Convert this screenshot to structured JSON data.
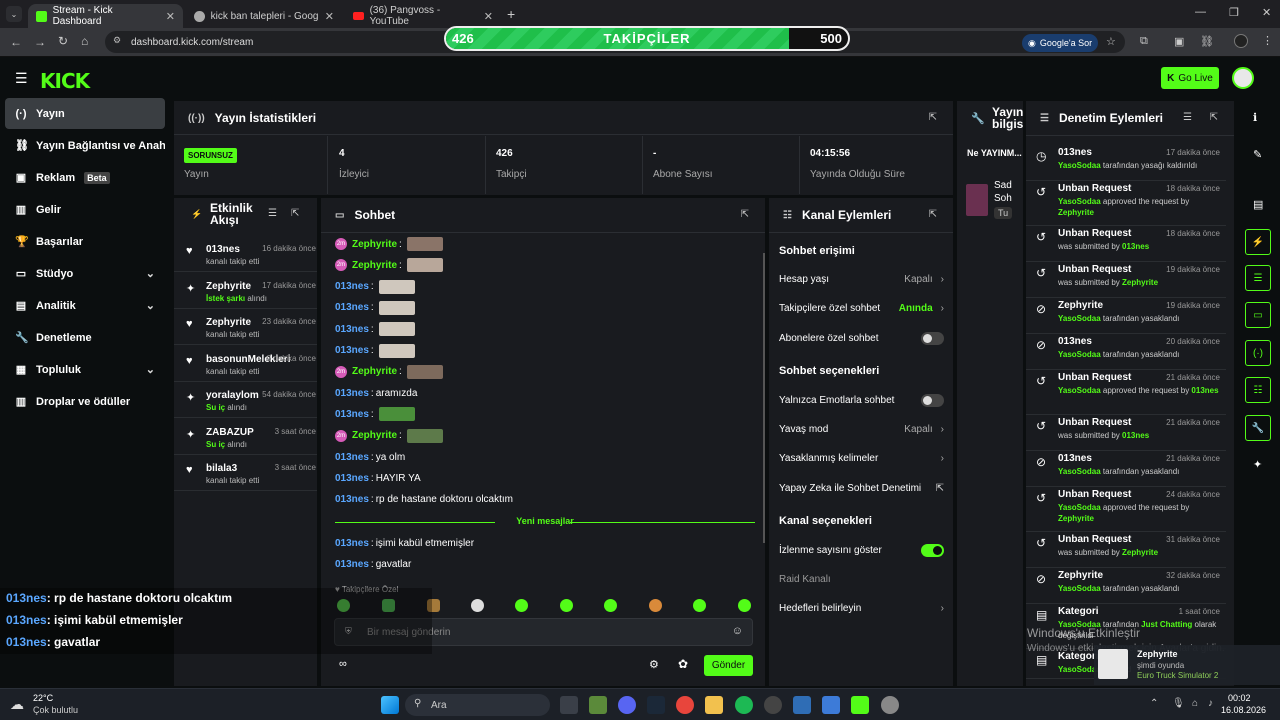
{
  "browser": {
    "tabs": [
      {
        "title": "Stream - Kick Dashboard",
        "active": true
      },
      {
        "title": "kick ban talepleri - Google'da A",
        "active": false
      },
      {
        "title": "(36) Pangvoss - YouTube",
        "active": false
      }
    ],
    "url": "dashboard.kick.com/stream",
    "google_btn": "Google'a Sor"
  },
  "followers_goal": {
    "label": "TAKİPÇİLER",
    "current": "426",
    "target": "500",
    "progress": 0.852
  },
  "header": {
    "logo": "KICK",
    "golive": "Go Live"
  },
  "sidebar": {
    "items": [
      {
        "label": "Yayın",
        "icon": "broadcast-icon",
        "selected": true
      },
      {
        "label": "Yayın Bağlantısı ve Anahtar",
        "icon": "link-icon"
      },
      {
        "label": "Reklam",
        "icon": "ad-icon",
        "badge": "Beta"
      },
      {
        "label": "Gelir",
        "icon": "chart-icon"
      },
      {
        "label": "Başarılar",
        "icon": "trophy-icon"
      },
      {
        "label": "Stüdyo",
        "icon": "studio-icon",
        "expandable": true
      },
      {
        "label": "Analitik",
        "icon": "analytics-icon",
        "expandable": true
      },
      {
        "label": "Denetleme",
        "icon": "wrench-icon"
      },
      {
        "label": "Topluluk",
        "icon": "community-icon",
        "expandable": true
      },
      {
        "label": "Droplar ve ödüller",
        "icon": "gift-icon"
      }
    ]
  },
  "stats": {
    "title": "Yayın İstatistikleri",
    "items": [
      {
        "value": "SORUNSUZ",
        "label": "Yayın"
      },
      {
        "value": "4",
        "label": "İzleyici"
      },
      {
        "value": "426",
        "label": "Takipçi"
      },
      {
        "value": "-",
        "label": "Abone Sayısı"
      },
      {
        "value": "04:15:56",
        "label": "Yayında Olduğu Süre"
      }
    ]
  },
  "stream_info": {
    "title": "Yayın bilgisi",
    "line1": "Ne YAYINM...",
    "line2": "Sad",
    "line3": "Soh",
    "tag": "Tu"
  },
  "activity": {
    "title": "Etkinlik Akışı",
    "items": [
      {
        "name": "013nes",
        "time": "16 dakika önce",
        "desc": "kanalı takip etti",
        "icon": "heart-icon"
      },
      {
        "name": "Zephyrite",
        "time": "17 dakika önce",
        "highlight": "İstek şarkı",
        "desc": "alındı",
        "icon": "gift-icon"
      },
      {
        "name": "Zephyrite",
        "time": "23 dakika önce",
        "desc": "kanalı takip etti",
        "icon": "heart-icon"
      },
      {
        "name": "basonunMelekleri",
        "time": "2 dakika önce",
        "desc": "kanalı takip etti",
        "icon": "heart-icon"
      },
      {
        "name": "yoralaylom",
        "time": "54 dakika önce",
        "highlight": "Su iç",
        "desc": "alındı",
        "icon": "gift-icon"
      },
      {
        "name": "ZABAZUP",
        "time": "3 saat önce",
        "highlight": "Su iç",
        "desc": "alındı",
        "icon": "gift-icon"
      },
      {
        "name": "bilala3",
        "time": "3 saat önce",
        "desc": "kanalı takip etti",
        "icon": "heart-icon"
      }
    ]
  },
  "chat": {
    "title": "Sohbet",
    "messages": [
      {
        "user": "Zephyrite",
        "color": "#53fc18",
        "text": "",
        "badge": true,
        "emote": "#8a7468"
      },
      {
        "user": "Zephyrite",
        "color": "#53fc18",
        "text": "",
        "badge": true,
        "emote": "#b8a79a"
      },
      {
        "user": "013nes",
        "color": "#5aa7ff",
        "text": "",
        "emote": "#cfc7bd"
      },
      {
        "user": "013nes",
        "color": "#5aa7ff",
        "text": "",
        "emote": "#cfc7bd"
      },
      {
        "user": "013nes",
        "color": "#5aa7ff",
        "text": "",
        "emote": "#cfc7bd"
      },
      {
        "user": "013nes",
        "color": "#5aa7ff",
        "text": "",
        "emote": "#cfc7bd"
      },
      {
        "user": "Zephyrite",
        "color": "#53fc18",
        "text": "",
        "badge": true,
        "emote": "#7d6a5c"
      },
      {
        "user": "013nes",
        "color": "#5aa7ff",
        "text": "aramızda"
      },
      {
        "user": "013nes",
        "color": "#5aa7ff",
        "text": "",
        "emote": "#4a8f3a"
      },
      {
        "user": "Zephyrite",
        "color": "#53fc18",
        "text": "",
        "badge": true,
        "emote": "#5d7a4a"
      },
      {
        "user": "013nes",
        "color": "#5aa7ff",
        "text": "ya olm"
      },
      {
        "user": "013nes",
        "color": "#5aa7ff",
        "text": "HAYIR YA"
      },
      {
        "user": "013nes",
        "color": "#5aa7ff",
        "text": "rp de hastane doktoru olcaktım"
      }
    ],
    "divider": "Yeni mesajlar",
    "new_messages": [
      {
        "user": "013nes",
        "color": "#5aa7ff",
        "text": "işimi kabül etmemişler"
      },
      {
        "user": "013nes",
        "color": "#5aa7ff",
        "text": "gavatlar"
      }
    ],
    "followers_only": "Takipçilere Özel",
    "placeholder": "Bir mesaj gönderin",
    "send": "Gönder"
  },
  "channel": {
    "title": "Kanal Eylemleri",
    "chat_access": "Sohbet erişimi",
    "account_age": "Hesap yaşı",
    "account_age_val": "Kapalı",
    "followers_chat": "Takipçilere özel sohbet",
    "followers_chat_val": "Anında",
    "subs_chat": "Abonelere özel sohbet",
    "chat_options": "Sohbet seçenekleri",
    "emote_only": "Yalnızca Emotlarla sohbet",
    "slow": "Yavaş mod",
    "slow_val": "Kapalı",
    "banned_words": "Yasaklanmış kelimeler",
    "ai_mod": "Yapay Zeka ile Sohbet Denetimi",
    "channel_options": "Kanal seçenekleri",
    "show_viewers": "İzlenme sayısını göster",
    "raid": "Raid Kanalı",
    "goals": "Hedefleri belirleyin"
  },
  "moderation": {
    "title": "Denetim Eylemleri",
    "items": [
      {
        "title": "013nes",
        "time": "17 dakika önce",
        "actor": "YasoSodaa",
        "desc": " tarafından yasağı kaldırıldı",
        "icon": "clock-icon",
        "h": 36
      },
      {
        "title": "Unban Request",
        "time": "18 dakika önce",
        "actor": "YasoSodaa",
        "desc": " approved the request by ",
        "target": "Zephyrite",
        "icon": "history-icon",
        "h": 45
      },
      {
        "title": "Unban Request",
        "time": "18 dakika önce",
        "actor": "",
        "desc": "was submitted by ",
        "target": "013nes",
        "icon": "history-icon",
        "h": 36
      },
      {
        "title": "Unban Request",
        "time": "19 dakika önce",
        "actor": "",
        "desc": "was submitted by ",
        "target": "Zephyrite",
        "icon": "history-icon",
        "h": 36
      },
      {
        "title": "Zephyrite",
        "time": "19 dakika önce",
        "actor": "YasoSodaa",
        "desc": " tarafından yasaklandı",
        "icon": "ban-icon",
        "h": 36
      },
      {
        "title": "013nes",
        "time": "20 dakika önce",
        "actor": "YasoSodaa",
        "desc": " tarafından yasaklandı",
        "icon": "ban-icon",
        "h": 36
      },
      {
        "title": "Unban Request",
        "time": "21 dakika önce",
        "actor": "YasoSodaa",
        "desc": " approved the request by ",
        "target": "013nes",
        "icon": "history-icon",
        "h": 45
      },
      {
        "title": "Unban Request",
        "time": "21 dakika önce",
        "actor": "",
        "desc": "was submitted by ",
        "target": "013nes",
        "icon": "history-icon",
        "h": 36
      },
      {
        "title": "013nes",
        "time": "21 dakika önce",
        "actor": "YasoSodaa",
        "desc": " tarafından yasaklandı",
        "icon": "ban-icon",
        "h": 36
      },
      {
        "title": "Unban Request",
        "time": "24 dakika önce",
        "actor": "YasoSodaa",
        "desc": " approved the request by ",
        "target": "Zephyrite",
        "icon": "history-icon",
        "h": 45
      },
      {
        "title": "Unban Request",
        "time": "31 dakika önce",
        "actor": "",
        "desc": "was submitted by ",
        "target": "Zephyrite",
        "icon": "history-icon",
        "h": 36
      },
      {
        "title": "Zephyrite",
        "time": "32 dakika önce",
        "actor": "YasoSodaa",
        "desc": " tarafından yasaklandı",
        "icon": "ban-icon",
        "h": 36
      },
      {
        "title": "Kategori",
        "time": "1 saat önce",
        "actor": "YasoSodaa",
        "desc": " tarafından ",
        "target": "Just Chatting",
        "tail": " olarak değiştirildi",
        "icon": "category-icon",
        "h": 45
      },
      {
        "title": "Kategori",
        "time": "",
        "actor": "YasoSodaa",
        "desc": "",
        "target": "",
        "tail": " olarak d",
        "icon": "category-icon",
        "h": 30
      }
    ]
  },
  "overlay": [
    {
      "user": "013nes",
      "text": ": rp de hastane doktoru olcaktım"
    },
    {
      "user": "013nes",
      "text": ": işimi kabül etmemişler"
    },
    {
      "user": "013nes",
      "text": ": gavatlar"
    }
  ],
  "toast": {
    "name": "Zephyrite",
    "status": "şimdi oyunda",
    "game": "Euro Truck Simulator 2"
  },
  "watermark": {
    "line1": "Windows'u Etkinleştir",
    "line2": "Windows'u etkinleştirmek için Ayarlar'a gidin."
  },
  "taskbar": {
    "weather_temp": "22°C",
    "weather_desc": "Çok bulutlu",
    "search": "Ara",
    "time": "00:02",
    "date": "16.08.2026"
  }
}
